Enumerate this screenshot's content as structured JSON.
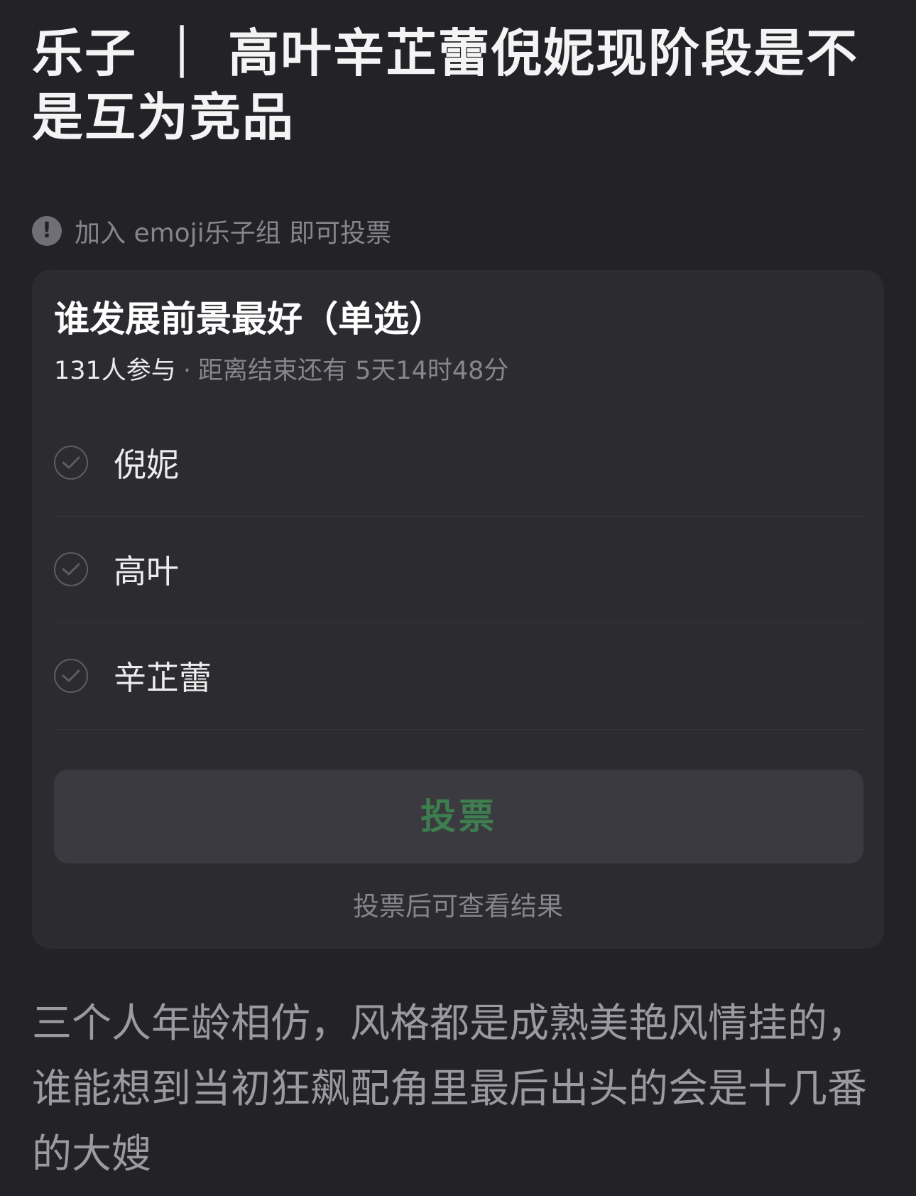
{
  "post": {
    "title": "乐子 ｜ 高叶辛芷蕾倪妮现阶段是不是互为竞品",
    "body": "三个人年龄相仿，风格都是成熟美艳风情挂的，谁能想到当初狂飙配角里最后出头的会是十几番的大嫂"
  },
  "notice": {
    "icon": "exclamation-circle-icon",
    "text": "加入 emoji乐子组 即可投票"
  },
  "poll": {
    "question": "谁发展前景最好（单选）",
    "participants": "131人参与",
    "separator": "·",
    "deadline": "距离结束还有 5天14时48分",
    "options": [
      {
        "label": "倪妮"
      },
      {
        "label": "高叶"
      },
      {
        "label": "辛芷蕾"
      }
    ],
    "vote_button": "投票",
    "hint": "投票后可查看结果"
  },
  "colors": {
    "background": "#222227",
    "card": "#2b2b30",
    "vote_text": "#3e7d4e"
  }
}
